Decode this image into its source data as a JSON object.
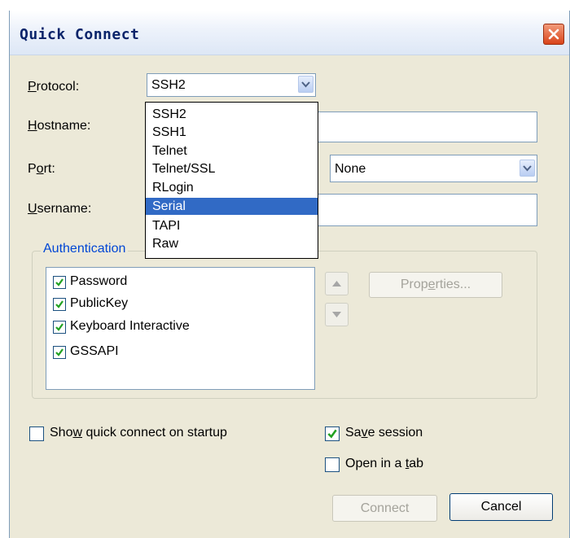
{
  "window": {
    "title": "Quick Connect"
  },
  "labels": {
    "protocol": {
      "pre": "",
      "u": "P",
      "post": "rotocol:"
    },
    "hostname": {
      "pre": "",
      "u": "H",
      "post": "ostname:"
    },
    "port": {
      "pre": "P",
      "u": "o",
      "post": "rt:"
    },
    "username": {
      "pre": "",
      "u": "U",
      "post": "sername:"
    }
  },
  "protocol": {
    "selected": "SSH2",
    "options": [
      "SSH2",
      "SSH1",
      "Telnet",
      "Telnet/SSL",
      "RLogin",
      "Serial",
      "TAPI",
      "Raw"
    ],
    "highlighted": "Serial"
  },
  "firewall": {
    "selected": "None"
  },
  "authentication": {
    "title": "Authentication",
    "methods": [
      {
        "label": "Password",
        "checked": true
      },
      {
        "label": "PublicKey",
        "checked": true
      },
      {
        "label": "Keyboard Interactive",
        "checked": true
      },
      {
        "label": "GSSAPI",
        "checked": true
      }
    ],
    "properties_button": {
      "pre": "Prop",
      "u": "e",
      "post": "rties..."
    }
  },
  "options": {
    "show_quick_connect": {
      "pre": "Sho",
      "u": "w",
      "post": " quick connect on startup",
      "checked": false
    },
    "save_session": {
      "pre": "Sa",
      "u": "v",
      "post": "e session",
      "checked": true
    },
    "open_in_tab": {
      "pre": "Open in a ",
      "u": "t",
      "post": "ab",
      "checked": false
    }
  },
  "buttons": {
    "connect": "Connect",
    "cancel": "Cancel"
  },
  "colors": {
    "accent": "#316ac5",
    "group_title": "#0046d5",
    "close": "#d9441a"
  }
}
